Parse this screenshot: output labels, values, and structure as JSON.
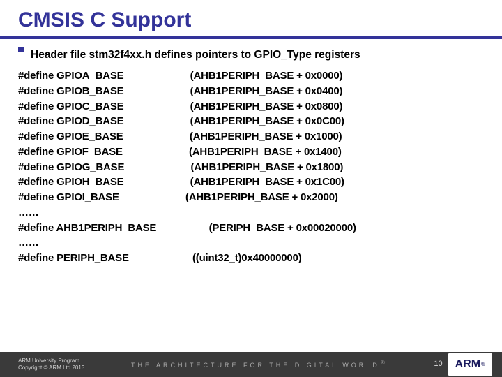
{
  "title": "CMSIS C Support",
  "bullet": "Header file stm32f4xx.h defines pointers to GPIO_Type registers",
  "defines": [
    {
      "sym": "GPIOA_BASE",
      "val": "(AHB1PERIPH_BASE + 0x0000)"
    },
    {
      "sym": "GPIOB_BASE",
      "val": "(AHB1PERIPH_BASE + 0x0400)"
    },
    {
      "sym": "GPIOC_BASE",
      "val": "(AHB1PERIPH_BASE + 0x0800)"
    },
    {
      "sym": "GPIOD_BASE",
      "val": "(AHB1PERIPH_BASE + 0x0C00)"
    },
    {
      "sym": "GPIOE_BASE",
      "val": "(AHB1PERIPH_BASE + 0x1000)"
    },
    {
      "sym": "GPIOF_BASE",
      "val": "(AHB1PERIPH_BASE + 0x1400)"
    },
    {
      "sym": "GPIOG_BASE",
      "val": "(AHB1PERIPH_BASE + 0x1800)"
    },
    {
      "sym": "GPIOH_BASE",
      "val": "(AHB1PERIPH_BASE + 0x1C00)"
    },
    {
      "sym": "GPIOI_BASE",
      "val": "(AHB1PERIPH_BASE + 0x2000)"
    }
  ],
  "ellipsis": "……",
  "ahb_define": {
    "sym": "AHB1PERIPH_BASE",
    "val": "(PERIPH_BASE + 0x00020000)"
  },
  "periph_define": {
    "sym": "PERIPH_BASE",
    "val": "((uint32_t)0x40000000)"
  },
  "keyword": "#define",
  "footer": {
    "line1": "ARM University Program",
    "line2": "Copyright © ARM Ltd 2013",
    "tagline": "THE ARCHITECTURE FOR THE DIGITAL WORLD",
    "page": "10",
    "logo": "ARM",
    "reg": "®"
  }
}
